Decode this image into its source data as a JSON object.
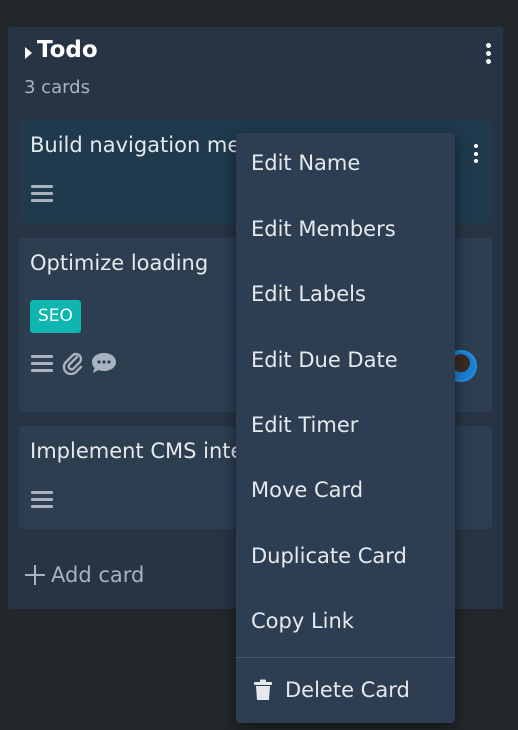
{
  "column": {
    "title": "Todo",
    "count": "3 cards"
  },
  "cards": [
    {
      "title": "Build navigation menu"
    },
    {
      "title": "Optimize loading",
      "label": "SEO"
    },
    {
      "title": "Implement CMS integration"
    }
  ],
  "add_card_label": "Add card",
  "context_menu": {
    "items": [
      "Edit Name",
      "Edit Members",
      "Edit Labels",
      "Edit Due Date",
      "Edit Timer",
      "Move Card",
      "Duplicate Card",
      "Copy Link"
    ],
    "delete_label": "Delete Card"
  },
  "icons": {
    "collapse": "caret-right-icon",
    "column_menu": "kebab-icon",
    "description": "description-icon",
    "attachment": "paperclip-icon",
    "comments": "comment-icon",
    "add": "plus-icon",
    "delete": "trash-icon"
  },
  "colors": {
    "background": "#22272b",
    "column": "#263445",
    "card": "#2c3e50",
    "label_seo": "#0fb5b0",
    "menu": "#2d3e52"
  }
}
